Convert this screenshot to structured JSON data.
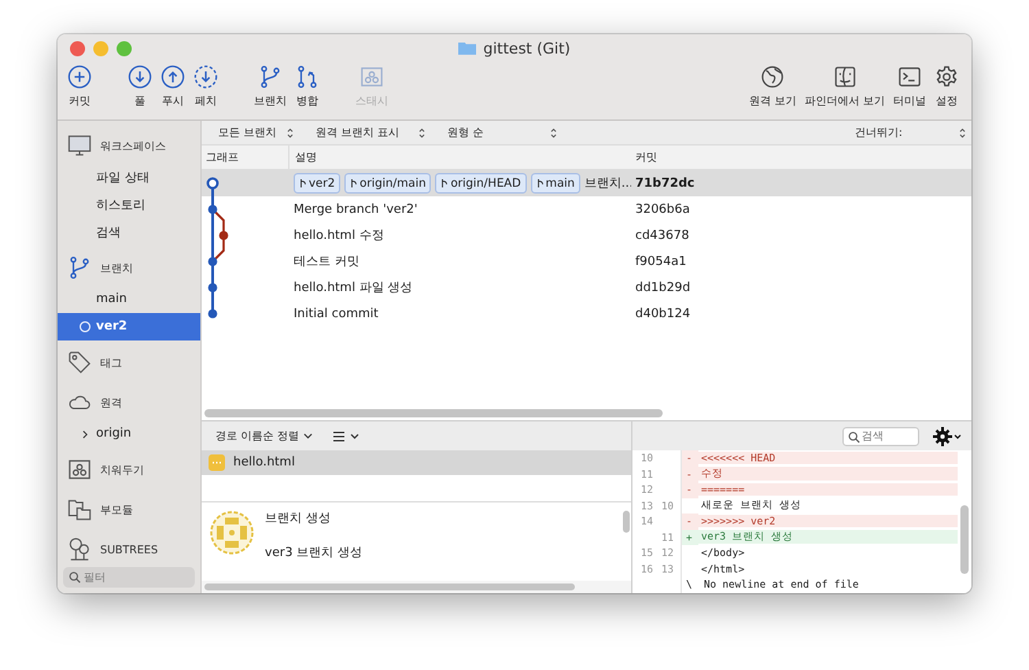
{
  "window": {
    "title": "gittest (Git)"
  },
  "toolbar": {
    "left": [
      {
        "label": "커밋",
        "disabled": false
      },
      {
        "label": "풀",
        "disabled": false
      },
      {
        "label": "푸시",
        "disabled": false
      },
      {
        "label": "페치",
        "disabled": false
      },
      {
        "label": "브랜치",
        "disabled": false
      },
      {
        "label": "병합",
        "disabled": false
      },
      {
        "label": "스태시",
        "disabled": true
      }
    ],
    "right": [
      {
        "label": "원격 보기"
      },
      {
        "label": "파인더에서 보기"
      },
      {
        "label": "터미널"
      },
      {
        "label": "설정"
      }
    ]
  },
  "sidebar": {
    "items": [
      {
        "kind": "header",
        "label": "워크스페이스"
      },
      {
        "kind": "item",
        "label": "파일 상태",
        "selected": false
      },
      {
        "kind": "item",
        "label": "히스토리",
        "selected": false
      },
      {
        "kind": "item",
        "label": "검색",
        "selected": false
      },
      {
        "kind": "header",
        "label": "브랜치"
      },
      {
        "kind": "item",
        "label": "main",
        "selected": false
      },
      {
        "kind": "branch",
        "label": "ver2",
        "selected": true
      },
      {
        "kind": "header",
        "label": "태그"
      },
      {
        "kind": "header",
        "label": "원격"
      },
      {
        "kind": "remote",
        "label": "origin",
        "selected": false
      },
      {
        "kind": "header",
        "label": "치워두기"
      },
      {
        "kind": "header",
        "label": "부모듈"
      },
      {
        "kind": "header",
        "label": "SUBTREES"
      }
    ],
    "filter": {
      "placeholder": "필터"
    }
  },
  "filter_bar": {
    "selectors": [
      "모든 브랜치",
      "원격 브랜치 표시",
      "원형 순"
    ],
    "skip_label": "건너뛰기:"
  },
  "table": {
    "columns": [
      "그래프",
      "설명",
      "커밋"
    ],
    "rows": [
      {
        "kind": "open",
        "refs": [
          "ver2",
          "origin/main",
          "origin/HEAD",
          "main"
        ],
        "description": "브랜치...",
        "hash": "71b72dc",
        "selected": true
      },
      {
        "kind": "main",
        "refs": [],
        "description": "Merge branch 'ver2'",
        "hash": "3206b6a",
        "selected": false
      },
      {
        "kind": "side",
        "refs": [],
        "description": "hello.html 수정",
        "hash": "cd43678",
        "selected": false
      },
      {
        "kind": "main",
        "refs": [],
        "description": "테스트 커밋",
        "hash": "f9054a1",
        "selected": false
      },
      {
        "kind": "main",
        "refs": [],
        "description": "hello.html 파일 생성",
        "hash": "dd1b29d",
        "selected": false
      },
      {
        "kind": "main",
        "refs": [],
        "description": "Initial commit",
        "hash": "d40b124",
        "selected": false
      }
    ]
  },
  "files": {
    "sort_label": "경로 이름순 정렬",
    "items": [
      {
        "name": "hello.html",
        "selected": true
      }
    ]
  },
  "commit_detail": {
    "lines": [
      "브랜치 생성",
      "ver3 브랜치 생성"
    ]
  },
  "diff": {
    "search": {
      "placeholder": "검색"
    },
    "lines": [
      {
        "kind": "del",
        "old": "10",
        "sign": "-",
        "text": "<<<<<<< HEAD"
      },
      {
        "kind": "del",
        "old": "11",
        "sign": "-",
        "text": "수정"
      },
      {
        "kind": "del",
        "old": "12",
        "sign": "-",
        "text": "======="
      },
      {
        "kind": "ctx",
        "old": "13",
        "new": "10",
        "text": "새로운 브랜치 생성"
      },
      {
        "kind": "del",
        "old": "14",
        "sign": "-",
        "text": ">>>>>>> ver2"
      },
      {
        "kind": "add",
        "new": "11",
        "sign": "+",
        "text": "ver3 브랜치 생성"
      },
      {
        "kind": "ctx",
        "old": "15",
        "new": "12",
        "text": "</body>"
      },
      {
        "kind": "ctx",
        "old": "16",
        "new": "13",
        "text": "</html>"
      },
      {
        "kind": "note",
        "sign": "\\",
        "text": "No newline at end of file"
      }
    ]
  }
}
